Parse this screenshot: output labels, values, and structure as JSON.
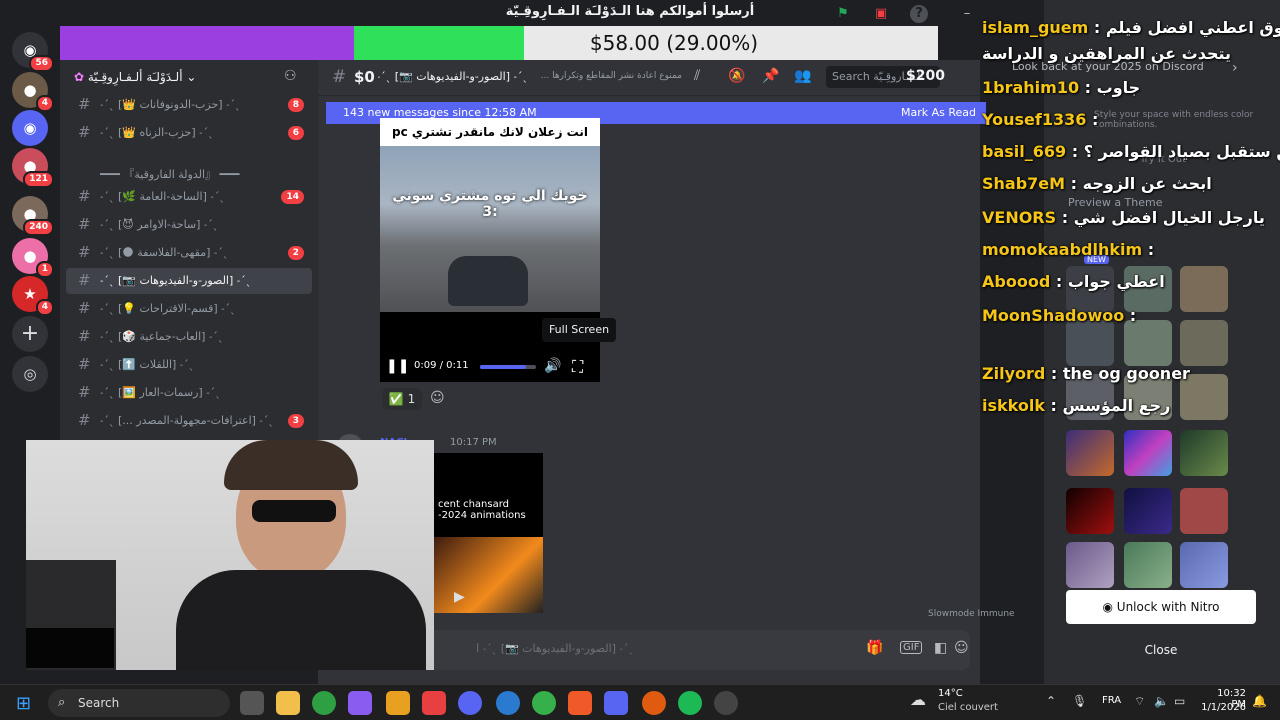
{
  "window": {
    "title": "أرسلوا أموالكم هنا    الـدَوْلـَة الـفـارِوقِـيّة"
  },
  "donation": {
    "amount_text": "$58.00 (29.00%)",
    "progress": 0.29,
    "colors": {
      "filled": "#9b3fe0",
      "current": "#2ee05a",
      "empty": "#e9e9e9"
    }
  },
  "servers": {
    "badges": [
      "56",
      "4",
      "121",
      "240",
      "1",
      "4"
    ]
  },
  "guild": {
    "name": "ألـدَوْلـَة ألـفـارِوقِـيّة"
  },
  "channels": [
    {
      "name": "ˎˊ˗ [حزب-الدونوفانات 👑] ˎˊ˗",
      "count": "8"
    },
    {
      "name": "ˎˊ˗ [حزب-الزناه 👑] ˎˊ˗",
      "count": "6"
    },
    {
      "name": "━━━ 『الدولة الفاروقية』 ━━━",
      "count": ""
    },
    {
      "name": "ˎˊ˗ [الساحة-العامة 🌿] ˎˊ˗",
      "count": "14"
    },
    {
      "name": "ˎˊ˗ [ساحة-الاوامر 😈] ˎˊ˗",
      "count": ""
    },
    {
      "name": "ˎˊ˗ [مقهى-الفلاسفة 🌑] ˎˊ˗",
      "count": "2"
    },
    {
      "name": "ˎˊ˗ [الصور-و-الفيديوهات 📷] ˎˊ˗",
      "count": ""
    },
    {
      "name": "ˎˊ˗ [قسم-الاقتراحات 💡] ˎˊ˗",
      "count": ""
    },
    {
      "name": "ˎˊ˗ [العاب-جماعية 🎲] ˎˊ˗",
      "count": ""
    },
    {
      "name": "ˎˊ˗ [اللقلات ⬆️] ˎˊ˗",
      "count": ""
    },
    {
      "name": "ˎˊ˗ [رسمات-العار 🖼️] ˎˊ˗",
      "count": ""
    },
    {
      "name": "ˎˊ˗ [اعترافات-مجهولة-المصدر ...] ˎˊ˗",
      "count": "3"
    }
  ],
  "topbar": {
    "channel_name": "ˎˊ˗ [الصور-و-الفيديوهات 📷] ˎˊ˗",
    "topic": "ممنوع اعادة نشر المقاطع وتكرارها ...",
    "search_placeholder": "Search الـفـاروقِـيّة",
    "goal_left": "$0",
    "goal_right": "$200"
  },
  "new_messages": {
    "text": "143 new messages since 12:58 AM",
    "action": "Mark As Read"
  },
  "video": {
    "caption": "انت زعلان لانك مانقدر تشتري pc",
    "subtitle": "خويك الي توه مشتري سوني 3:",
    "time": "0:09 / 0:11",
    "progress": 0.82,
    "tooltip": "Full Screen"
  },
  "reaction": {
    "emoji": "✅",
    "count": "1"
  },
  "message2": {
    "author": "NACI",
    "time": "10:17 PM",
    "attachment_text": "cent chansard -2024 animations"
  },
  "input": {
    "placeholder": "ˎˊ˗ [الصور-و-الفيديوهات 📷] ˎˊ˗ ا"
  },
  "slowmode": "Slowmode Immune",
  "chat": [
    {
      "user": "islam_guem",
      "text": "فاروق اعطني افضل فيلم"
    },
    {
      "user": "",
      "text": "يتحدث عن المراهقين و الدراسة"
    },
    {
      "user": "1brahim10",
      "text": "جاوب"
    },
    {
      "user": "Yousef1336",
      "text": ""
    },
    {
      "user": "basil_669",
      "text": "من ستقبل بصياد القواصر ؟"
    },
    {
      "user": "Shab7eM",
      "text": "ابحث عن الزوجه"
    },
    {
      "user": "VENORS",
      "text": "يارجل الخيال افضل شي"
    },
    {
      "user": "momokaabdlhkim",
      "text": ""
    },
    {
      "user": "Aboood",
      "text": "اعطي جواب"
    },
    {
      "user": "MoonShadowoo",
      "text": ""
    },
    {
      "user": "Zilyord",
      "text": "the og gooner"
    },
    {
      "user": "iskkolk",
      "text": "رجع المؤسس"
    }
  ],
  "right_panel": {
    "banner": "Look back at your 2025 on Discord",
    "style_hint": "Style your space with endless color combinations.",
    "try_it": "Try It Out",
    "preview": "Preview a Theme",
    "nitro_button": "Unlock with Nitro",
    "close_button": "Close",
    "new_badge": "NEW"
  },
  "taskbar": {
    "search": "Search",
    "weather_temp": "14°C",
    "weather_desc": "Ciel couvert",
    "lang": "FRA",
    "time": "10:32 PM",
    "date": "1/1/2026"
  }
}
